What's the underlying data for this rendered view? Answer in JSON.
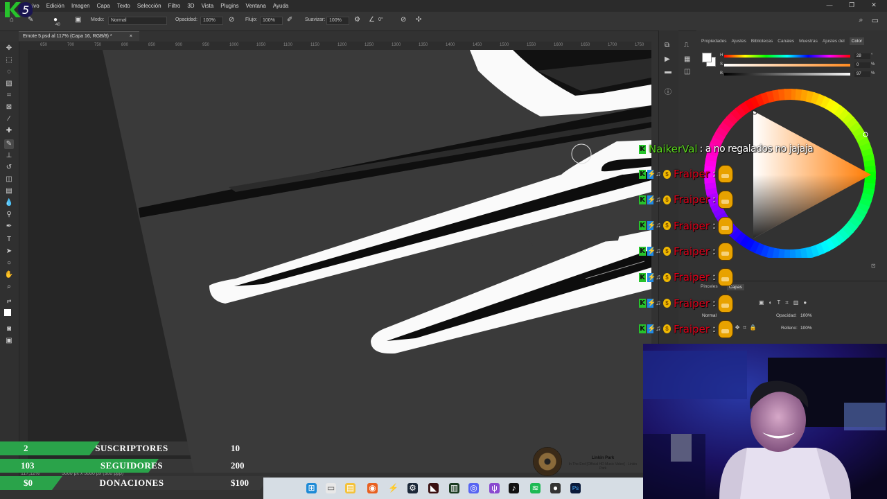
{
  "menubar": {
    "items": [
      "Archivo",
      "Edición",
      "Imagen",
      "Capa",
      "Texto",
      "Selección",
      "Filtro",
      "3D",
      "Vista",
      "Plugins",
      "Ventana",
      "Ayuda"
    ],
    "window_controls": [
      "—",
      "❐",
      "✕"
    ]
  },
  "options_bar": {
    "brush_size": "40",
    "mode_label": "Modo:",
    "mode_value": "Normal",
    "opacity_label": "Opacidad:",
    "opacity_value": "100%",
    "flow_label": "Flujo:",
    "flow_value": "100%",
    "smoothing_label": "Suavizar:",
    "smoothing_value": "100%",
    "angle_value": "0°"
  },
  "document": {
    "tab_title": "Emote 5.psd al 117% (Capa 16, RGB/8) *",
    "close_symbol": "×",
    "status": "117,12%",
    "doc_size": "5000 px x 5000 px (300 ppp)"
  },
  "ruler": {
    "labels": [
      "650",
      "700",
      "750",
      "800",
      "850",
      "900",
      "950",
      "1000",
      "1050",
      "1100",
      "1150",
      "1200",
      "1250",
      "1300",
      "1350",
      "1400",
      "1450",
      "1500",
      "1550",
      "1600",
      "1650",
      "1700",
      "1750"
    ]
  },
  "color_panel": {
    "tabs": [
      "Propiedades",
      "Ajustes",
      "Bibliotecas",
      "Canales",
      "Muestras",
      "Ajustes del",
      "Color"
    ],
    "active_tab": "Color",
    "h_label": "H",
    "h_value": "28",
    "s_label": "S",
    "s_value": "0",
    "b_label": "B",
    "b_value": "97",
    "unit_h": "°",
    "unit_pct": "%"
  },
  "layers_panel": {
    "tabs": [
      "Pinceles",
      "Capas"
    ],
    "blend_mode": "Normal",
    "opacity_label": "Opacidad:",
    "opacity_value": "100%",
    "fill_label": "Relleno:",
    "fill_value": "100%"
  },
  "chat": {
    "first": {
      "user": "NaikerVal",
      "message": ": a no regalados no jajaja"
    },
    "repeat_user": "Fraiper",
    "repeat_sep": ":",
    "repeat_count": 7
  },
  "stream_stats": {
    "rows": [
      {
        "current": "2",
        "label": "SUSCRIPTORES",
        "goal": "10",
        "color": "#2aa34a",
        "progress": 0.2
      },
      {
        "current": "103",
        "label": "SEGUIDORES",
        "goal": "200",
        "color": "#2aa34a",
        "progress": 0.515
      },
      {
        "current": "$0",
        "label": "DONACIONES",
        "goal": "$100",
        "color": "#2aa34a",
        "progress": 0.0
      }
    ]
  },
  "music": {
    "artist": "Linkin Park",
    "track": "In The End [Official HD Music Video] - Linkin Park"
  },
  "overlay_logo": "5",
  "colors": {
    "accent_green": "#27c22c",
    "chat_red": "#e2001a",
    "chat_green": "#5bd61e"
  }
}
